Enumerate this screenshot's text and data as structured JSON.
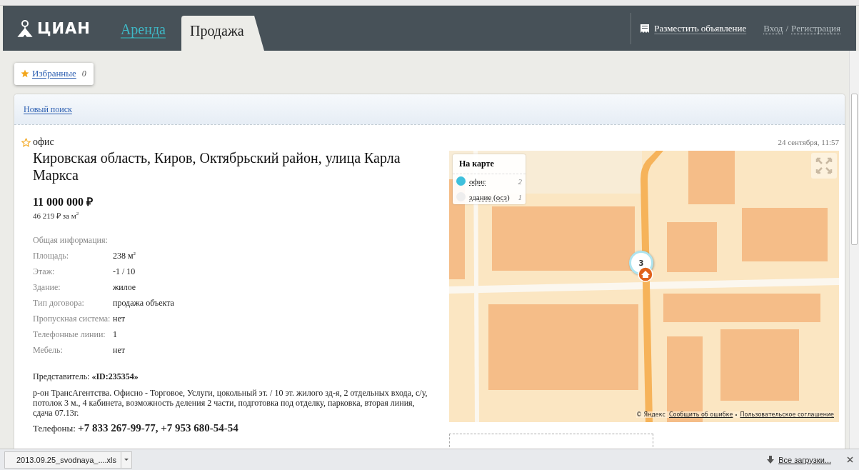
{
  "header": {
    "logo": "ЦИАН",
    "tabs": [
      {
        "label": "Аренда",
        "selected": false
      },
      {
        "label": "Продажа",
        "selected": true
      }
    ],
    "post_ad": "Разместить объявление",
    "login": "Вход",
    "separator": "/",
    "register": "Регистрация"
  },
  "favorites": {
    "label": "Избранные",
    "count": "0"
  },
  "new_search": "Новый поиск",
  "listing": {
    "type": "офис",
    "favorite": false,
    "date": "24 сентября, 11:57",
    "address": "Кировская область, Киров, Октябрьский район, улица Карла Маркса",
    "price": "11 000 000 ₽",
    "price_per_m2": "46 219 ₽ за м$^{2}$",
    "info_title": "Общая информация:",
    "info": [
      {
        "label": "Площадь:",
        "value": "238 м$^{2}$"
      },
      {
        "label": "Этаж:",
        "value": "-1 / 10"
      },
      {
        "label": "Здание:",
        "value": "жилое"
      },
      {
        "label": "Тип договора:",
        "value": "продажа объекта"
      },
      {
        "label": "Пропускная система:",
        "value": "нет"
      },
      {
        "label": "Телефонные линии:",
        "value": "1"
      },
      {
        "label": "Мебель:",
        "value": "нет"
      }
    ],
    "agent_label": "Представитель:",
    "agent": "«ID:235354»",
    "description": "р-он ТрансАгентства. Офисно - Торговое, Услуги, цокольный эт. / 10 эт. жилого зд-я, 2 отдельных входа, с/у, потолок 3 м., 4 кабинета, возможность деления 2 части, подготовка под отделку, парковка, вторая линия, сдача 07.13г.",
    "phones_label": "Телефоны:",
    "phones": "+7 833 267-99-77, +7 953 680-54-54"
  },
  "map": {
    "legend_title": "На карте",
    "legend": [
      {
        "label": "офис",
        "count": "2",
        "color": "#3fc0dc"
      },
      {
        "label": "здание (осз)",
        "count": "1",
        "color": "#eeeeee"
      }
    ],
    "cluster": "3",
    "copyright": "© Яндекс",
    "links": [
      "Сообщить об ошибке",
      "Пользовательское соглашение"
    ]
  },
  "downloads": {
    "file": "2013.09.25_svodnaya_....xls",
    "all": "Все загрузки..."
  }
}
